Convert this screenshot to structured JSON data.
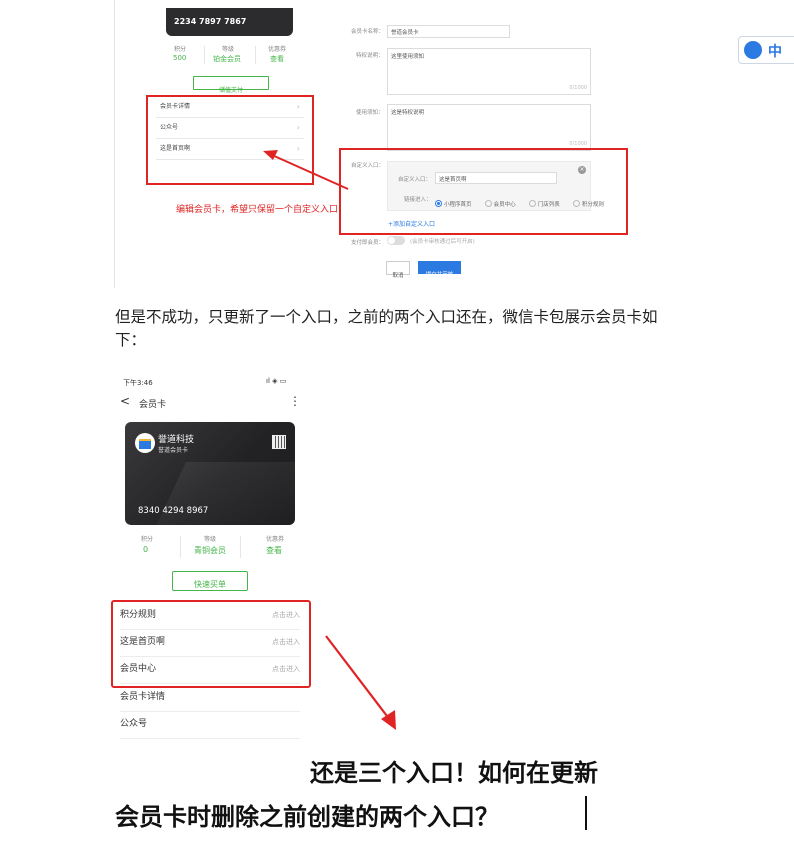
{
  "top_screenshot": {
    "card_number": "2234 7897 7867",
    "stats": [
      {
        "label": "积分",
        "value": "500"
      },
      {
        "label": "等级",
        "value": "铂金会员"
      },
      {
        "label": "优惠券",
        "value": "查看"
      }
    ],
    "quick_button": "储值支付",
    "menu_items": [
      "会员卡详情",
      "公众号",
      "这是首页啊"
    ],
    "annotation": "编辑会员卡，希望只保留一个自定义入口",
    "form": {
      "card_name_label": "会员卡名称：",
      "card_name_value": "誉道会员卡",
      "privilege_label": "特权说明：",
      "privilege_value": "这里使用须知",
      "privilege_counter": "0/1000",
      "notice_label": "使用须知：",
      "notice_value": "这是特权说明",
      "notice_counter": "0/1000",
      "custom_entry_label": "自定义入口：",
      "entry_name_label": "自定义入口：",
      "entry_name_value": "这是首页啊",
      "link_label": "链接进入：",
      "link_options": [
        "小程序首页",
        "会员中心",
        "门店列表",
        "积分规则"
      ],
      "add_entry_link": "+添加自定义入口",
      "pay_member_label": "支付即会员：",
      "pay_member_hint": "(会员卡审核通过后可开启)",
      "cancel_button": "取消",
      "submit_button": "提交并审核"
    }
  },
  "paragraph": "但是不成功，只更新了一个入口，之前的两个入口还在，微信卡包展示会员卡如下：",
  "phone": {
    "time": "下午3:46",
    "status_icons": "ıl ◈ ▭",
    "nav_title": "会员卡",
    "back_glyph": "<",
    "more_glyph": "⋮",
    "brand": "誉道科技",
    "card_type": "誉道会员卡",
    "card_number": "8340 4294 8967",
    "stats": [
      {
        "label": "积分",
        "value": "0"
      },
      {
        "label": "等级",
        "value": "青铜会员"
      },
      {
        "label": "优惠券",
        "value": "查看"
      }
    ],
    "quick_button": "快速买单",
    "entries": [
      {
        "label": "积分规则",
        "hint": "点击进入"
      },
      {
        "label": "这是首页啊",
        "hint": "点击进入"
      },
      {
        "label": "会员中心",
        "hint": "点击进入"
      }
    ],
    "other_items": [
      "会员卡详情",
      "公众号"
    ]
  },
  "question_line1": "还是三个入口！如何在更新",
  "question_line2": "会员卡时删除之前创建的两个入口？",
  "side_widget": {
    "label": "中"
  },
  "colors": {
    "red": "#e02424",
    "green": "#44b549",
    "blue": "#2a7ae2",
    "dark_card": "#2c2c2e"
  }
}
